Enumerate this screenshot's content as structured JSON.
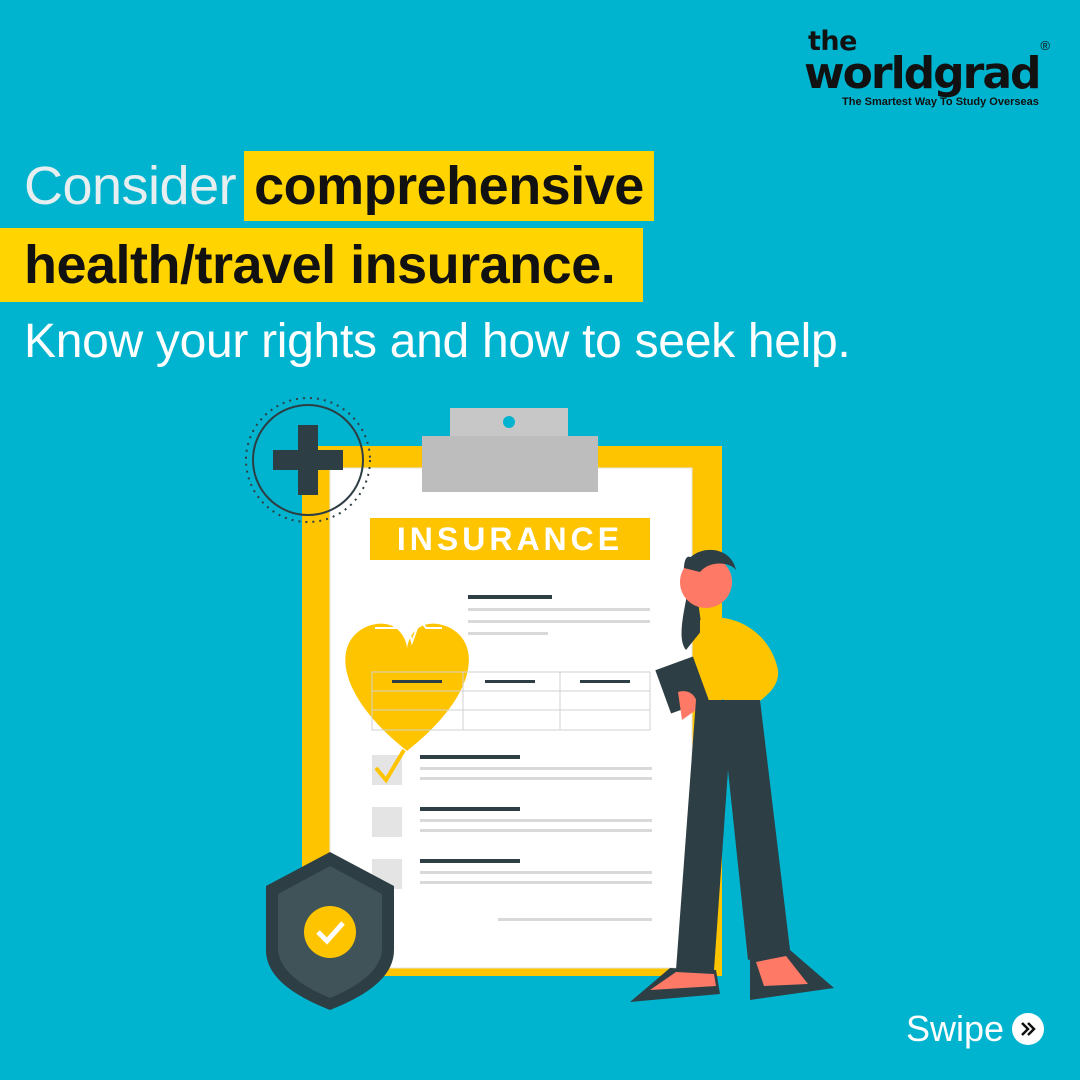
{
  "brand": {
    "logo_the": "the",
    "logo_name": "worldgrad",
    "registered_mark": "®",
    "tagline": "The Smartest Way To Study Overseas"
  },
  "headline": {
    "word1": "Consider",
    "highlight1": "comprehensive",
    "highlight2": "health/travel insurance.",
    "subline": "Know your rights and how to seek help."
  },
  "illustration": {
    "clipboard_label": "INSURANCE",
    "icons": [
      "plus-icon",
      "heart-pulse-icon",
      "check-icon",
      "shield-check-icon"
    ]
  },
  "footer": {
    "swipe_label": "Swipe",
    "swipe_icon": "double-chevron-right-icon"
  },
  "colors": {
    "background": "#00b4cf",
    "accent_yellow": "#ffd400",
    "dark": "#2d3e44"
  }
}
